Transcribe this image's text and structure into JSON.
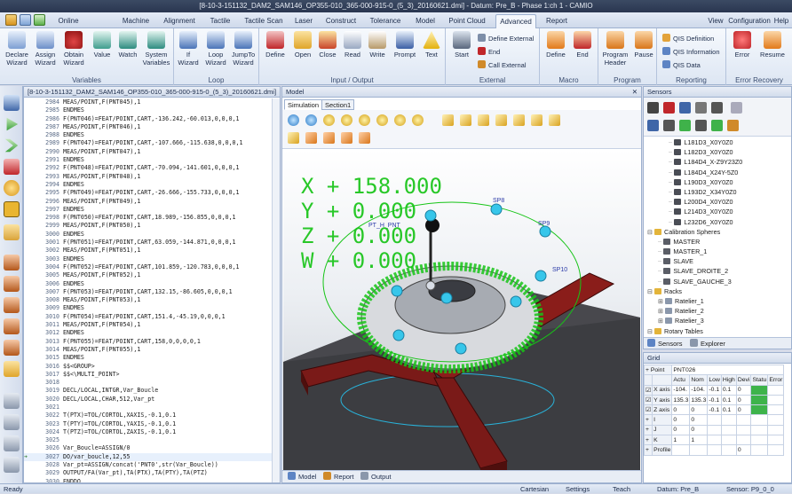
{
  "window_title": "[8-10-3-151132_DAM2_SAM146_OP355-010_365-000-915-0_(5_3)_20160621.dmi] - Datum: Pre_B - Phase 1:ch 1 - CAMIO",
  "tabs": [
    "Online",
    "Machine",
    "Alignment",
    "Tactile",
    "Tactile Scan",
    "Laser",
    "Construct",
    "Tolerance",
    "Model",
    "Point Cloud",
    "Advanced",
    "Report"
  ],
  "active_tab": "Advanced",
  "right_menu": {
    "view": "View",
    "config": "Configuration",
    "help": "Help"
  },
  "ribbon": {
    "variables": {
      "label": "Variables",
      "declare": [
        "Declare",
        "Wizard"
      ],
      "assign": [
        "Assign",
        "Wizard"
      ],
      "obtain": [
        "Obtain",
        "Wizard"
      ],
      "value": "Value",
      "watch": "Watch",
      "system": [
        "System",
        "Variables"
      ]
    },
    "loop": {
      "label": "Loop",
      "if": [
        "If",
        "Wizard"
      ],
      "loop": [
        "Loop",
        "Wizard"
      ],
      "jumpto": [
        "JumpTo",
        "Wizard"
      ]
    },
    "io": {
      "label": "Input / Output",
      "define": "Define",
      "open": "Open",
      "close": "Close",
      "read": "Read",
      "write": "Write",
      "prompt": "Prompt",
      "text": "Text"
    },
    "external": {
      "label": "External",
      "start": "Start",
      "define_external": "Define External",
      "end": "End",
      "call_external": "Call External"
    },
    "macro": {
      "label": "Macro",
      "define": "Define",
      "end": "End"
    },
    "program": {
      "label": "Program",
      "header": [
        "Program",
        "Header"
      ],
      "pause": "Pause"
    },
    "reporting": {
      "label": "Reporting",
      "qis_def": "QIS Definition",
      "qis_info": "QIS Information",
      "qis_data": "QIS Data"
    },
    "error": {
      "label": "Error Recovery",
      "error": "Error",
      "resume": "Resume"
    }
  },
  "editor": {
    "title": "[8-10-3-151132_DAM2_SAM146_OP355-010_365-000-915-0_(5_3)_20160621.dmi]",
    "lines": [
      [
        "2984",
        "MEAS/POINT,F(PNT045),1"
      ],
      [
        "2985",
        "ENDMES"
      ],
      [
        "2986",
        "F(PNT046)=FEAT/POINT,CART,-136.242,-60.013,0,0,0,1"
      ],
      [
        "2987",
        "MEAS/POINT,F(PNT046),1"
      ],
      [
        "2988",
        "ENDMES"
      ],
      [
        "2989",
        "F(PNT047)=FEAT/POINT,CART,-107.666,-115.638,0,0,0,1"
      ],
      [
        "2990",
        "MEAS/POINT,F(PNT047),1"
      ],
      [
        "2991",
        "ENDMES"
      ],
      [
        "2992",
        "F(PNT048)=FEAT/POINT,CART,-70.094,-141.601,0,0,0,1"
      ],
      [
        "2993",
        "MEAS/POINT,F(PNT048),1"
      ],
      [
        "2994",
        "ENDMES"
      ],
      [
        "2995",
        "F(PNT049)=FEAT/POINT,CART,-26.666,-155.733,0,0,0,1"
      ],
      [
        "2996",
        "MEAS/POINT,F(PNT049),1"
      ],
      [
        "2997",
        "ENDMES"
      ],
      [
        "2998",
        "F(PNT050)=FEAT/POINT,CART,18.989,-156.855,0,0,0,1"
      ],
      [
        "2999",
        "MEAS/POINT,F(PNT050),1"
      ],
      [
        "3000",
        "ENDMES"
      ],
      [
        "3001",
        "F(PNT051)=FEAT/POINT,CART,63.059,-144.871,0,0,0,1"
      ],
      [
        "3002",
        "MEAS/POINT,F(PNT051),1"
      ],
      [
        "3003",
        "ENDMES"
      ],
      [
        "3004",
        "F(PNT052)=FEAT/POINT,CART,101.859,-120.783,0,0,0,1"
      ],
      [
        "3005",
        "MEAS/POINT,F(PNT052),1"
      ],
      [
        "3006",
        "ENDMES"
      ],
      [
        "3007",
        "F(PNT053)=FEAT/POINT,CART,132.15,-86.605,0,0,0,1"
      ],
      [
        "3008",
        "MEAS/POINT,F(PNT053),1"
      ],
      [
        "3009",
        "ENDMES"
      ],
      [
        "3010",
        "F(PNT054)=FEAT/POINT,CART,151.4,-45.19,0,0,0,1"
      ],
      [
        "3011",
        "MEAS/POINT,F(PNT054),1"
      ],
      [
        "3012",
        "ENDMES"
      ],
      [
        "3013",
        "F(PNT055)=FEAT/POINT,CART,158,0,0,0,0,1"
      ],
      [
        "3014",
        "MEAS/POINT,F(PNT055),1"
      ],
      [
        "3015",
        "ENDMES"
      ],
      [
        "3016",
        "$$<GROUP>"
      ],
      [
        "3017",
        "$$<\\MULTI_POINT>"
      ],
      [
        "3018",
        ""
      ],
      [
        "3019",
        "DECL/LOCAL,INTGR,Var_Boucle"
      ],
      [
        "3020",
        "DECL/LOCAL,CHAR,512,Var_pt"
      ],
      [
        "3021",
        ""
      ],
      [
        "3022",
        "T(PTX)=TOL/CORTOL,XAXIS,-0.1,0.1"
      ],
      [
        "3023",
        "T(PTY)=TOL/CORTOL,YAXIS,-0.1,0.1"
      ],
      [
        "3024",
        "T(PTZ)=TOL/CORTOL,ZAXIS,-0.1,0.1"
      ],
      [
        "3025",
        ""
      ],
      [
        "3026",
        "Var_Boucle=ASSIGN/0"
      ],
      [
        "3027",
        "DO/var_boucle,12,55"
      ],
      [
        "3028",
        "Var_pt=ASSIGN/concat('PNT0',str(Var_Boucle))"
      ],
      [
        "3029",
        "OUTPUT/FA(Var_pt),TA(PTX),TA(PTY),TA(PTZ)"
      ],
      [
        "3030",
        "ENDDO"
      ]
    ],
    "active_line": "3027"
  },
  "model": {
    "title": "Model",
    "tabs": [
      "Simulation",
      "Section1"
    ],
    "axes": [
      [
        "X",
        "+ 158.000"
      ],
      [
        "Y",
        "+ 0.000"
      ],
      [
        "Z",
        "+ 0.000"
      ],
      [
        "W",
        "+ 0.000"
      ]
    ],
    "bottom_tabs": [
      "Model",
      "Report",
      "Output"
    ]
  },
  "sensors": {
    "title": "Sensors",
    "items": [
      {
        "t": "L181D3_X0Y0Z0",
        "lvl": 2,
        "k": "p"
      },
      {
        "t": "L182D3_X0Y0Z0",
        "lvl": 2,
        "k": "p"
      },
      {
        "t": "L184D4_X-Z9Y23Z0",
        "lvl": 2,
        "k": "p"
      },
      {
        "t": "L184D4_X24Y-5Z0",
        "lvl": 2,
        "k": "p"
      },
      {
        "t": "L190D3_X0Y0Z0",
        "lvl": 2,
        "k": "p"
      },
      {
        "t": "L193D2_X34Y0Z0",
        "lvl": 2,
        "k": "p"
      },
      {
        "t": "L200D4_X0Y0Z0",
        "lvl": 2,
        "k": "p"
      },
      {
        "t": "L214D3_X0Y0Z0",
        "lvl": 2,
        "k": "p"
      },
      {
        "t": "L232D6_X0Y0Z0",
        "lvl": 2,
        "k": "p"
      },
      {
        "t": "Calibration Spheres",
        "lvl": 0,
        "k": "f"
      },
      {
        "t": "MASTER",
        "lvl": 1,
        "k": "s"
      },
      {
        "t": "MASTER_1",
        "lvl": 1,
        "k": "s"
      },
      {
        "t": "SLAVE",
        "lvl": 1,
        "k": "s"
      },
      {
        "t": "SLAVE_DROITE_2",
        "lvl": 1,
        "k": "s"
      },
      {
        "t": "SLAVE_GAUCHE_3",
        "lvl": 1,
        "k": "s"
      },
      {
        "t": "Racks",
        "lvl": 0,
        "k": "f"
      },
      {
        "t": "Ratelier_1",
        "lvl": 1,
        "k": "r"
      },
      {
        "t": "Ratelier_2",
        "lvl": 1,
        "k": "r"
      },
      {
        "t": "Ratelier_3",
        "lvl": 1,
        "k": "r"
      },
      {
        "t": "Rotary Tables",
        "lvl": 0,
        "k": "f"
      }
    ],
    "tabs": [
      "Sensors",
      "Explorer"
    ]
  },
  "grid": {
    "title": "Grid",
    "point_label": "Point",
    "point_value": "PNT026",
    "headers": [
      "Actu",
      "Nom",
      "Low",
      "High",
      "Devi",
      "Statu",
      "Error"
    ],
    "rows": [
      {
        "name": "X axis",
        "vals": [
          "-104.",
          "-104.",
          "-0.1",
          "0.1",
          "0",
          "",
          ""
        ]
      },
      {
        "name": "Y axis",
        "vals": [
          "135.3",
          "135.3",
          "-0.1",
          "0.1",
          "0",
          "",
          ""
        ]
      },
      {
        "name": "Z axis",
        "vals": [
          "0",
          "0",
          "-0.1",
          "0.1",
          "0",
          "",
          ""
        ]
      },
      {
        "name": "I",
        "vals": [
          "0",
          "0",
          "",
          "",
          "",
          "",
          ""
        ]
      },
      {
        "name": "J",
        "vals": [
          "0",
          "0",
          "",
          "",
          "",
          "",
          ""
        ]
      },
      {
        "name": "K",
        "vals": [
          "1",
          "1",
          "",
          "",
          "",
          "",
          ""
        ]
      },
      {
        "name": "Profile",
        "vals": [
          "",
          "",
          "",
          "",
          "0",
          "",
          ""
        ]
      }
    ]
  },
  "status": {
    "ready": "Ready",
    "cartesian": "Cartesian",
    "settings": "Settings",
    "teach": "Teach",
    "datum": "Datum: Pre_B",
    "sensor": "Sensor: P9_0_0"
  },
  "colors": {
    "accent": "#1f4e8c",
    "green": "#17c417",
    "ok": "#3db34a",
    "base": "#7a1a18"
  }
}
